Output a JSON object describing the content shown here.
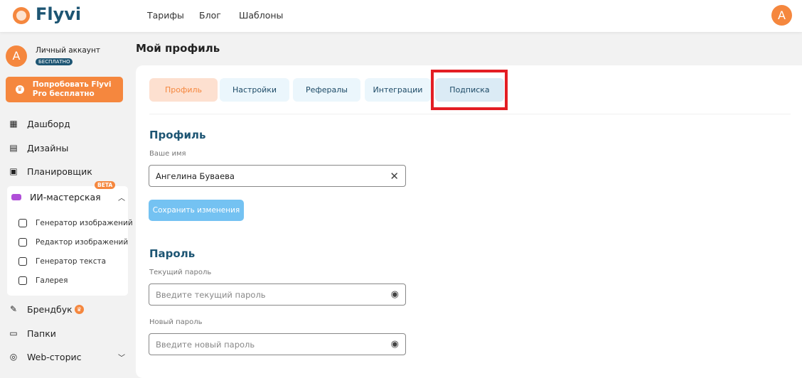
{
  "header": {
    "logo": "Flyvi",
    "nav": [
      "Тарифы",
      "Блог",
      "Шаблоны"
    ],
    "avatar_letter": "A"
  },
  "sidebar": {
    "account": {
      "avatar_letter": "A",
      "name": "Личный аккаунт",
      "plan_badge": "БЕСПЛАТНО"
    },
    "promo_button": "Попробовать Flyvi Pro бесплатно",
    "items": [
      {
        "label": "Дашборд"
      },
      {
        "label": "Дизайны"
      },
      {
        "label": "Планировщик"
      }
    ],
    "ai_group": {
      "label": "ИИ-мастерская",
      "badge": "BETA",
      "subitems": [
        "Генератор изображений",
        "Редактор изображений",
        "Генератор текста",
        "Галерея"
      ]
    },
    "items2": [
      {
        "label": "Брендбук"
      },
      {
        "label": "Папки"
      },
      {
        "label": "Web-сторис"
      }
    ]
  },
  "main": {
    "title": "Мой профиль",
    "tabs": [
      "Профиль",
      "Настройки",
      "Рефералы",
      "Интеграции",
      "Подписка"
    ],
    "profile": {
      "heading": "Профиль",
      "name_label": "Ваше имя",
      "name_value": "Ангелина Буваева",
      "save_button": "Сохранить изменения"
    },
    "password": {
      "heading": "Пароль",
      "current_label": "Текущий пароль",
      "current_placeholder": "Введите текущий пароль",
      "new_label": "Новый пароль",
      "new_placeholder": "Введите новый пароль"
    }
  },
  "colors": {
    "accent": "#f5873e",
    "brand": "#1d5573",
    "highlight": "#e31e24"
  }
}
